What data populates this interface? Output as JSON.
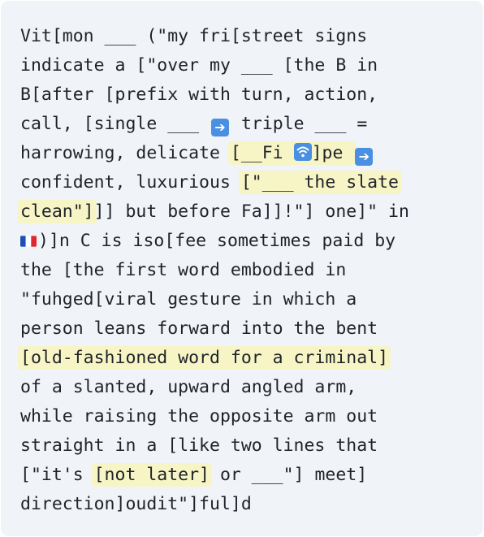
{
  "colors": {
    "card_background": "#f0f3f7",
    "highlight": "#f7f5c6",
    "text": "#1f2328",
    "arrow_icon": "#4a90e2",
    "wifi_icon": "#4a90e2"
  },
  "puzzle": {
    "l1": "Vit[mon ___ (\"my fri[street signs",
    "l2": "indicate a [\"over my ___ [the B in",
    "l3": "B[after [prefix with turn, action,",
    "l4a": "call, [single ___ ",
    "l4b": " triple ___ =",
    "l5a": "harrowing, delicate ",
    "l5hl": "[__Fi ",
    "l5b": "]pe ",
    "l6a": "confident, luxurious ",
    "l6hl": "[\"___ the slate",
    "l7hl": "clean\"]",
    "l7b": "]] but before Fa]]!\"] one]\" in",
    "l8": ")]n C is iso[fee sometimes paid by",
    "l9": "the [the first word embodied in",
    "l10": "\"fuhged[viral gesture in which a",
    "l11": "person leans forward into the bent",
    "l12hl": "[old-fashioned word for a criminal]",
    "l13": "of a slanted, upward angled arm,",
    "l14": "while raising the opposite arm out",
    "l15": "straight in a [like two lines that",
    "l16a": "[\"it's ",
    "l16hl": "[not later]",
    "l16b": " or ___\"] meet]",
    "l17": "direction]oudit\"]ful]d"
  },
  "icons": {
    "arrow": "right-arrow-icon",
    "wifi": "wifi-icon",
    "flag": "france-flag-icon"
  }
}
